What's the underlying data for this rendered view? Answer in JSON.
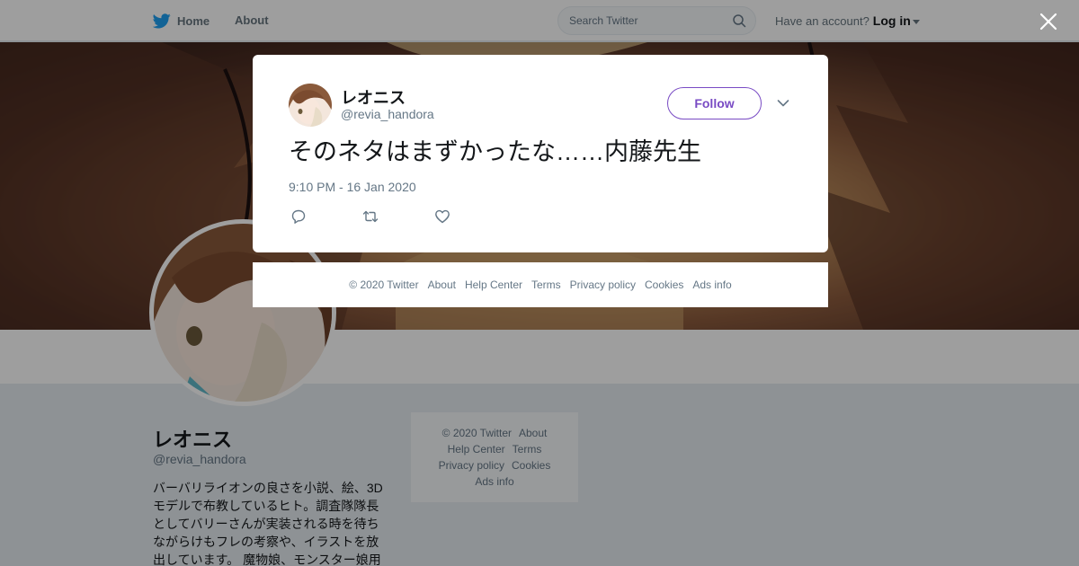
{
  "topbar": {
    "home_label": "Home",
    "about_label": "About",
    "search_placeholder": "Search Twitter",
    "account_prompt": "Have an account?",
    "login_label": "Log in"
  },
  "profile": {
    "name": "レオニス",
    "handle": "@revia_handora",
    "bio": "バーバリライオンの良さを小説、絵、3Dモデルで布教しているヒト。調査隊隊長としてバリーさんが実装される時を待ちながらけもフレの考察や、イラストを放出しています。 魔物娘、モンスター娘用"
  },
  "side_footer": {
    "row1": [
      "© 2020 Twitter",
      "About"
    ],
    "row2": [
      "Help Center",
      "Terms"
    ],
    "row3": [
      "Privacy policy",
      "Cookies"
    ],
    "row4": [
      "Ads info"
    ]
  },
  "tweet": {
    "name": "レオニス",
    "handle": "@revia_handora",
    "follow_label": "Follow",
    "text": "そのネタはまずかったな……内藤先生",
    "timestamp": "9:10 PM - 16 Jan 2020"
  },
  "modal_footer": {
    "links": [
      "© 2020 Twitter",
      "About",
      "Help Center",
      "Terms",
      "Privacy policy",
      "Cookies",
      "Ads info"
    ]
  },
  "icons": {
    "bird": "twitter-bird-icon",
    "search": "search-icon",
    "close": "close-icon",
    "chevron": "chevron-down-icon",
    "reply": "reply-icon",
    "retweet": "retweet-icon",
    "like": "heart-icon"
  },
  "colors": {
    "brand_blue": "#1da1f2",
    "follow_purple": "#794bc4",
    "muted_text": "#657786"
  }
}
